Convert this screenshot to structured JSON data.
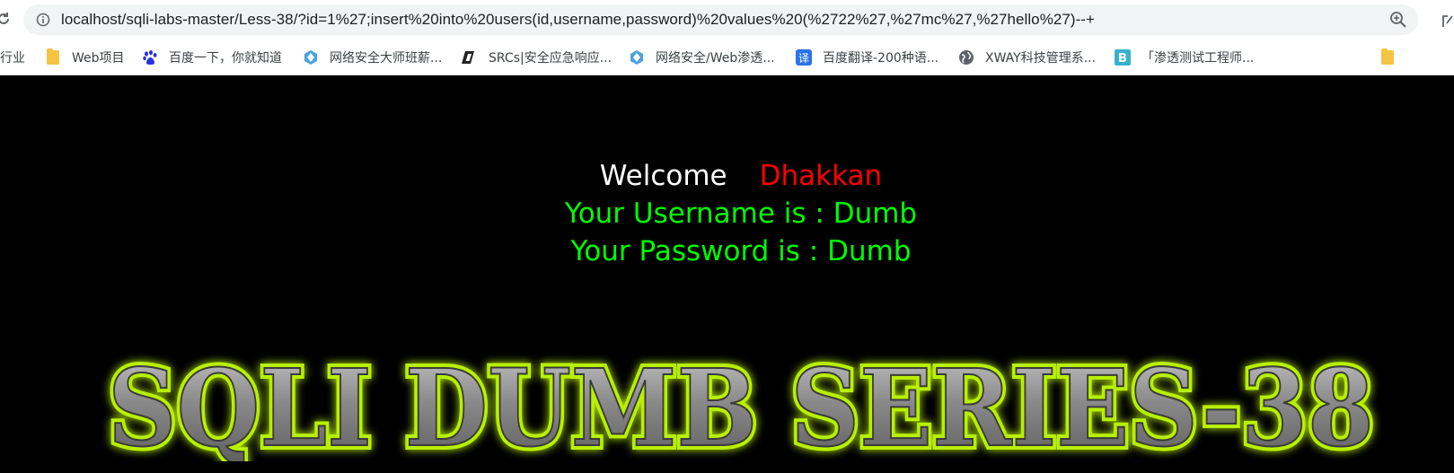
{
  "browser": {
    "url": "localhost/sqli-labs-master/Less-38/?id=1%27;insert%20into%20users(id,username,password)%20values%20(%2722%27,%27mc%27,%27hello%27)--+",
    "bookmarks": [
      {
        "label": "行业",
        "icon": "none"
      },
      {
        "label": "Web项目",
        "icon": "folder-icon"
      },
      {
        "label": "百度一下，你就知道",
        "icon": "baidu-paw-icon"
      },
      {
        "label": "网络安全大师班薪...",
        "icon": "shield-diamond-icon"
      },
      {
        "label": "SRCs|安全应急响应...",
        "icon": "slash-logo-icon"
      },
      {
        "label": "网络安全/Web渗透...",
        "icon": "shield-diamond-icon"
      },
      {
        "label": "百度翻译-200种语...",
        "icon": "translate-icon"
      },
      {
        "label": "XWAY科技管理系...",
        "icon": "globe-icon"
      },
      {
        "label": "「渗透测试工程师...",
        "icon": "b-letter-icon"
      }
    ]
  },
  "page": {
    "welcome": "Welcome",
    "name": "Dhakkan",
    "username_line": "Your Username is : Dumb",
    "password_line": "Your Password is : Dumb",
    "banner": "SQLI DUMB SERIES-38"
  },
  "colors": {
    "background": "#000000",
    "welcome": "#ffffff",
    "name": "#ff0000",
    "info": "#00ff00",
    "banner_glow": "#b8f000",
    "banner_metal": "#8a8a8a"
  }
}
